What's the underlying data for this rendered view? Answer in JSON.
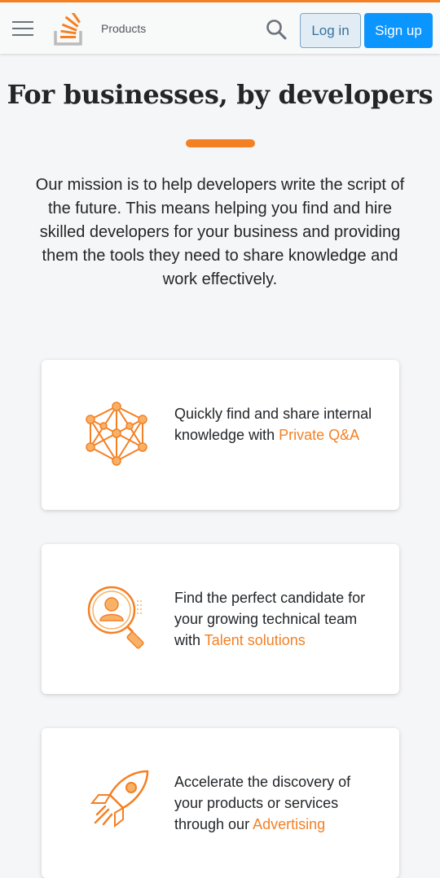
{
  "header": {
    "products_label": "Products",
    "login_label": "Log in",
    "signup_label": "Sign up"
  },
  "hero": {
    "title": "For businesses, by developers",
    "mission": "Our mission is to help developers write the script of the future. This means helping you find and hire skilled developers for your business and providing them the tools they need to share knowledge and work effectively."
  },
  "cards": [
    {
      "text": "Quickly find and share internal knowledge with ",
      "link": "Private Q&A",
      "icon": "network-icon"
    },
    {
      "text": "Find the perfect candidate for your growing technical team with ",
      "link": "Talent solutions",
      "icon": "candidate-search-icon"
    },
    {
      "text": "Accelerate the discovery of your products or services through our ",
      "link": "Advertising",
      "icon": "rocket-icon"
    }
  ],
  "colors": {
    "accent": "#f48024",
    "primary_button": "#0a95ff"
  }
}
